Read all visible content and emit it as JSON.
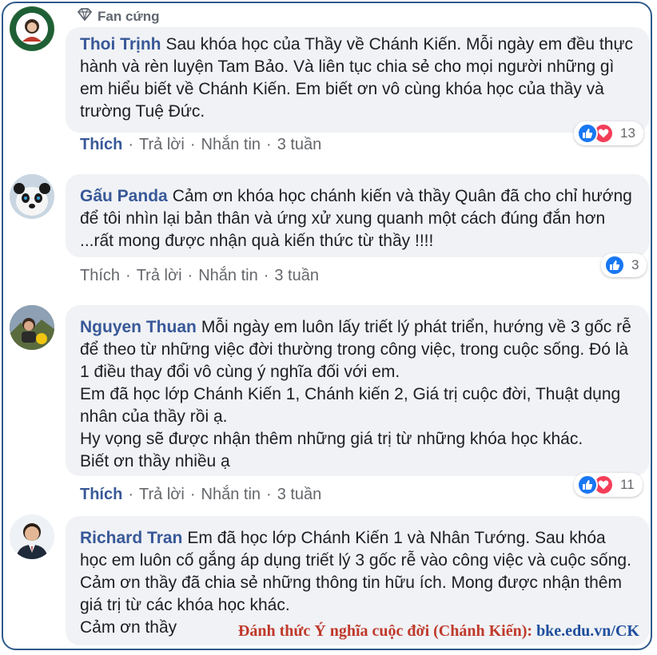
{
  "colors": {
    "author": "#385898",
    "like_active": "#385898",
    "frame": "#2e5a8c",
    "watermark_text": "#c0392b",
    "watermark_url": "#1f4e9c"
  },
  "comments": [
    {
      "author": "Thoi Trịnh",
      "badge": "Fan cứng",
      "text": "Sau khóa học của Thầy về Chánh Kiến. Mỗi ngày em đều thực hành và rèn luyện Tam Bảo. Và liên tục chia sẻ cho mọi người những gì em hiểu biết về Chánh Kiến. Em biết ơn vô cùng khóa học của thầy và trường Tuệ Đức.",
      "actions": {
        "like": "Thích",
        "reply": "Trả lời",
        "message": "Nhắn tin",
        "time": "3 tuần"
      },
      "reactions": {
        "icons": [
          "like-icon",
          "love-icon"
        ],
        "count": "13"
      }
    },
    {
      "author": "Gấu Panda",
      "text": "Cảm ơn khóa học chánh kiến và thầy Quân đã cho chỉ hướng để tôi nhìn lại bản thân và ứng xử xung quanh một cách đúng đắn hơn ...rất mong được nhận quà kiến thức từ thầy !!!!",
      "actions": {
        "like": "Thích",
        "reply": "Trả lời",
        "message": "Nhắn tin",
        "time": "3 tuần"
      },
      "reactions": {
        "icons": [
          "like-icon"
        ],
        "count": "3"
      }
    },
    {
      "author": "Nguyen Thuan",
      "text": "Mỗi ngày em luôn lấy triết lý phát triển, hướng về 3 gốc rễ để theo từ những việc đời thường trong công việc, trong cuộc sống. Đó là 1 điều thay đổi vô cùng ý nghĩa đối với em.\nEm đã học lớp Chánh Kiến 1, Chánh kiến 2, Giá trị cuộc đời, Thuật dụng nhân của thầy rồi ạ.\nHy vọng sẽ được nhận thêm những giá trị từ những khóa học khác.\nBiết ơn thầy nhiều ạ",
      "actions": {
        "like": "Thích",
        "reply": "Trả lời",
        "message": "Nhắn tin",
        "time": "3 tuần"
      },
      "reactions": {
        "icons": [
          "like-icon",
          "love-icon"
        ],
        "count": "11"
      }
    },
    {
      "author": "Richard Tran",
      "text": "Em đã học lớp Chánh Kiến 1 và Nhân Tướng. Sau khóa học em luôn cố gắng áp dụng triết lý 3 gốc rễ vào công việc và cuộc sống. Cảm ơn thầy đã chia sẻ những thông tin hữu ích. Mong được nhận thêm giá trị từ các khóa học khác.\nCảm ơn thầy"
    }
  ],
  "watermark": {
    "text": "Đánh thức Ý nghĩa cuộc đời (Chánh Kiến): ",
    "url": "bke.edu.vn/CK"
  }
}
